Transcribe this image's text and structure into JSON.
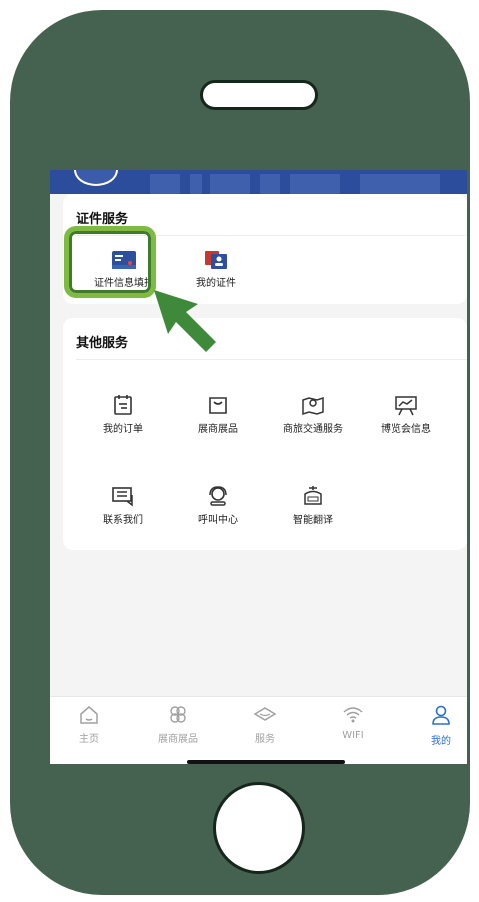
{
  "sections": {
    "certificate": {
      "title": "证件服务",
      "items": [
        {
          "label": "证件信息填报",
          "icon": "id-card-icon"
        },
        {
          "label": "我的证件",
          "icon": "badge-icon"
        }
      ]
    },
    "other": {
      "title": "其他服务",
      "items": [
        {
          "label": "我的订单",
          "icon": "clipboard-icon"
        },
        {
          "label": "展商展品",
          "icon": "shopping-bag-icon"
        },
        {
          "label": "商旅交通服务",
          "icon": "map-pin-icon"
        },
        {
          "label": "博览会信息",
          "icon": "presentation-board-icon"
        },
        {
          "label": "联系我们",
          "icon": "chat-icon"
        },
        {
          "label": "呼叫中心",
          "icon": "headset-icon"
        },
        {
          "label": "智能翻译",
          "icon": "translate-robot-icon"
        }
      ]
    }
  },
  "tabbar": {
    "items": [
      {
        "label": "主页",
        "icon": "home-icon"
      },
      {
        "label": "展商展品",
        "icon": "clover-icon"
      },
      {
        "label": "服务",
        "icon": "diamond-icon"
      },
      {
        "label": "WIFI",
        "icon": "wifi-icon"
      },
      {
        "label": "我的",
        "icon": "user-icon",
        "active": true
      }
    ]
  },
  "colors": {
    "phone_body": "#456150",
    "accent_blue": "#2a6fd6",
    "highlight_green": "#7dbb43",
    "arrow_green": "#3f8a3a",
    "banner_blue": "#2c4d9b"
  }
}
